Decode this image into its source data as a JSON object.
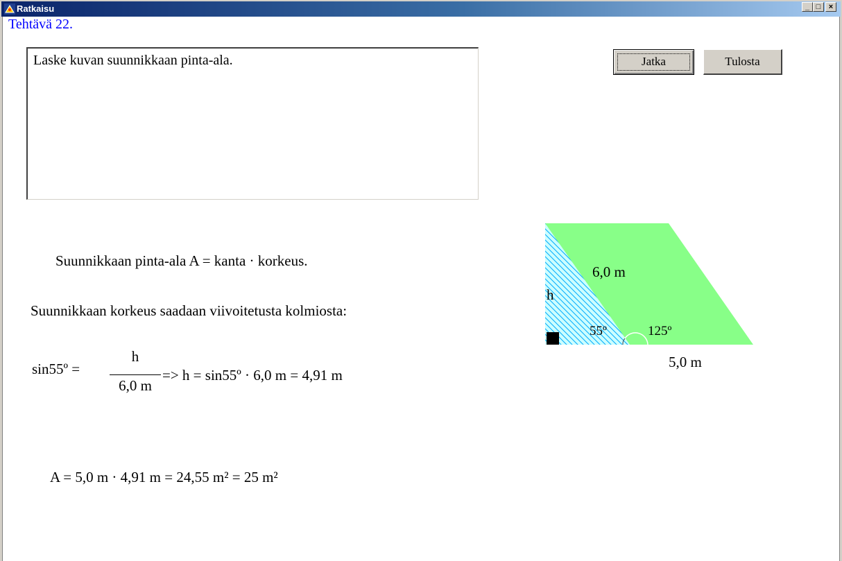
{
  "window": {
    "title": "Ratkaisu",
    "controls": {
      "minimize": "_",
      "maximize": "□",
      "close": "×"
    }
  },
  "task": {
    "title": "Tehtävä 22.",
    "question": "Laske kuvan suunnikkaan pinta-ala."
  },
  "buttons": {
    "continue_label": "Jatka",
    "print_label": "Tulosta"
  },
  "solution": {
    "line1": "Suunnikkaan pinta-ala A = kanta · korkeus.",
    "line2": "Suunnikkaan korkeus saadaan viivoitetusta kolmiosta:",
    "formula_lhs": "sin55º =",
    "formula_num": "h",
    "formula_den": "6,0 m",
    "formula_rhs": "=>  h = sin55º · 6,0 m =  4,91 m",
    "area": "A = 5,0 m ·  4,91 m = 24,55 m² =  25 m²"
  },
  "figure": {
    "side_label": "6,0 m",
    "height_label": "h",
    "angle_acute": "55º",
    "angle_obtuse": "125º",
    "base_label": "5,0 m",
    "colors": {
      "fill": "#88ff88",
      "hatch_bg": "#ccffff",
      "hatch": "#00aaff"
    }
  }
}
